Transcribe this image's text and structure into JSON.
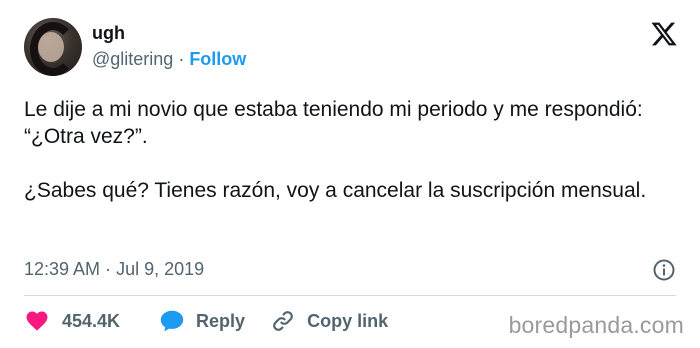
{
  "author": {
    "display_name": "ugh",
    "handle": "@glitering",
    "separator": " · ",
    "follow_label": "Follow"
  },
  "tweet": {
    "text": "Le dije a mi novio que estaba teniendo mi periodo y me respondió: “¿Otra vez?”.\n\n¿Sabes qué? Tienes razón, voy a cancelar la suscripción mensual.",
    "time": "12:39 AM",
    "separator": " · ",
    "date": "Jul 9, 2019"
  },
  "actions": {
    "like_count": "454.4K",
    "reply_label": "Reply",
    "copy_link_label": "Copy link"
  },
  "watermark": "boredpanda.com",
  "colors": {
    "accent": "#1d9bf0",
    "like": "#f91880",
    "text": "#0f1419",
    "secondary": "#536471",
    "divider": "#cfd9de"
  },
  "icons": [
    "avatar",
    "x-logo-icon",
    "info-icon",
    "heart-icon",
    "reply-bubble-icon",
    "link-icon"
  ]
}
